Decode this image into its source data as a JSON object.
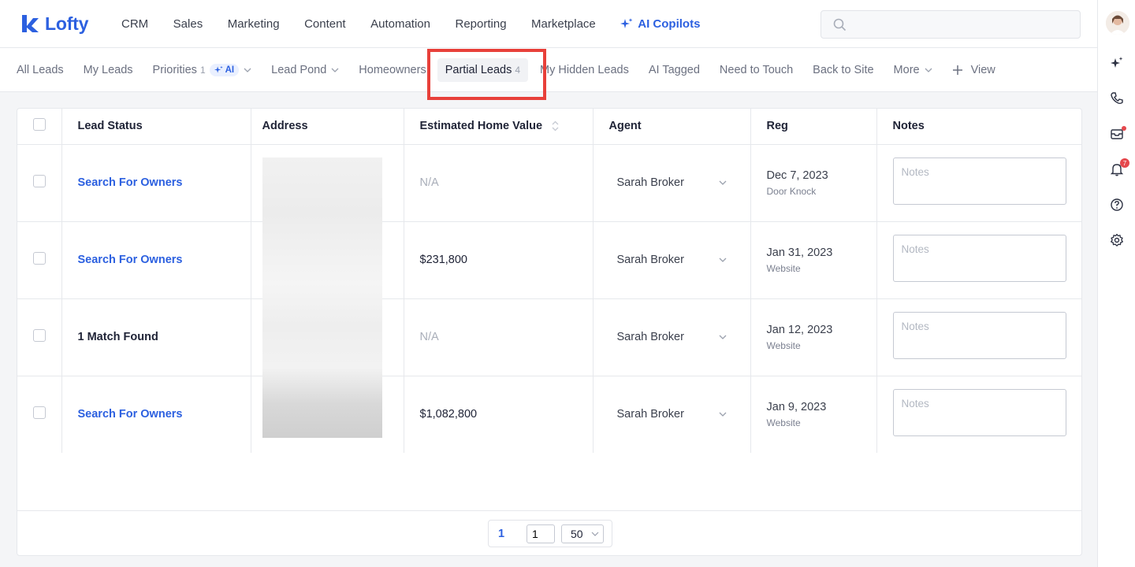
{
  "brand": {
    "name": "Lofty"
  },
  "nav": [
    {
      "label": "CRM"
    },
    {
      "label": "Sales"
    },
    {
      "label": "Marketing"
    },
    {
      "label": "Content"
    },
    {
      "label": "Automation"
    },
    {
      "label": "Reporting"
    },
    {
      "label": "Marketplace"
    }
  ],
  "nav_ai": {
    "label": "AI Copilots"
  },
  "search": {
    "placeholder": ""
  },
  "tabs": {
    "all_leads": "All Leads",
    "my_leads": "My Leads",
    "priorities": "Priorities",
    "priorities_count": "1",
    "ai_pill": "AI",
    "lead_pond": "Lead Pond",
    "homeowners": "Homeowners",
    "partial_leads": "Partial Leads",
    "partial_leads_count": "4",
    "my_hidden_leads": "My Hidden Leads",
    "ai_tagged": "AI Tagged",
    "need_to_touch": "Need to Touch",
    "back_to_site": "Back to Site",
    "more": "More",
    "view": "View"
  },
  "table": {
    "headers": {
      "lead_status": "Lead Status",
      "address": "Address",
      "home_value": "Estimated Home Value",
      "agent": "Agent",
      "reg": "Reg",
      "notes": "Notes"
    },
    "notes_placeholder": "Notes",
    "rows": [
      {
        "status": "Search For Owners",
        "status_link": true,
        "value": "N/A",
        "agent": "Sarah Broker",
        "reg_date": "Dec 7, 2023",
        "reg_source": "Door Knock"
      },
      {
        "status": "Search For Owners",
        "status_link": true,
        "value": "$231,800",
        "agent": "Sarah Broker",
        "reg_date": "Jan 31, 2023",
        "reg_source": "Website"
      },
      {
        "status": "1 Match Found",
        "status_link": false,
        "value": "N/A",
        "agent": "Sarah Broker",
        "reg_date": "Jan 12, 2023",
        "reg_source": "Website"
      },
      {
        "status": "Search For Owners",
        "status_link": true,
        "value": "$1,082,800",
        "agent": "Sarah Broker",
        "reg_date": "Jan 9, 2023",
        "reg_source": "Website"
      }
    ]
  },
  "pagination": {
    "current_page": "1",
    "page_input": "1",
    "page_size": "50"
  },
  "rail": {
    "notification_count": "7"
  },
  "colors": {
    "brand": "#2c60e0",
    "highlight": "#e8403a",
    "badge": "#e5484d"
  }
}
